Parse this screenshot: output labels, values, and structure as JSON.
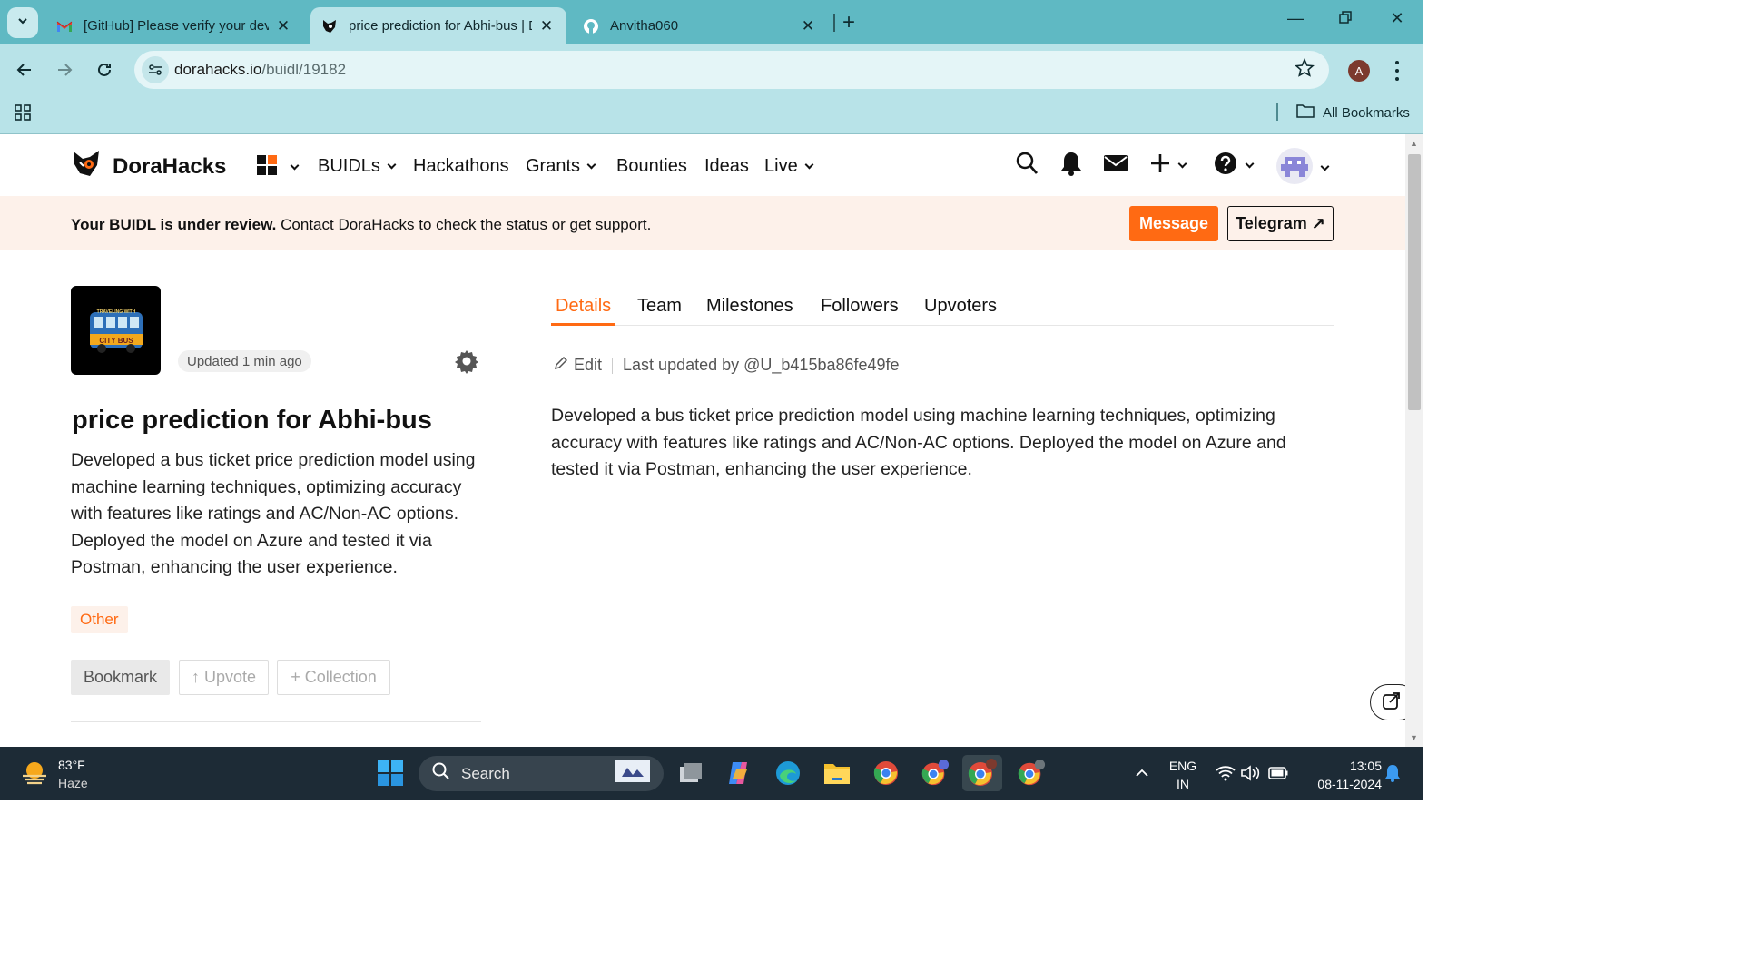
{
  "browser": {
    "tabs": [
      {
        "title": "[GitHub] Please verify your devi",
        "favicon": "gmail-icon",
        "active": false
      },
      {
        "title": "price prediction for Abhi-bus | D",
        "favicon": "dorahacks-icon",
        "active": true
      },
      {
        "title": "Anvitha060",
        "favicon": "github-icon",
        "active": false
      }
    ],
    "url_host": "dorahacks.io",
    "url_path": "/buidl/19182",
    "profile_initial": "A",
    "all_bookmarks": "All Bookmarks"
  },
  "site": {
    "logo": "DoraHacks",
    "nav": [
      {
        "label": "BUIDLs",
        "dropdown": true
      },
      {
        "label": "Hackathons",
        "dropdown": false
      },
      {
        "label": "Grants",
        "dropdown": true
      },
      {
        "label": "Bounties",
        "dropdown": false
      },
      {
        "label": "Ideas",
        "dropdown": false
      },
      {
        "label": "Live",
        "dropdown": true
      }
    ],
    "accent_color": "#ff6a13"
  },
  "banner": {
    "bold": "Your BUIDL is under review.",
    "text": " Contact DoraHacks to check the status or get support.",
    "message_btn": "Message",
    "telegram_btn": "Telegram ↗"
  },
  "project": {
    "updated": "Updated 1 min ago",
    "title": "price prediction for Abhi-bus",
    "description": "Developed a bus ticket price prediction model using machine learning techniques, optimizing accuracy with features like ratings and AC/Non-AC options. Deployed the model on Azure and tested it via Postman, enhancing the user experience.",
    "tag": "Other",
    "bookmark_btn": "Bookmark",
    "upvote_btn": "↑ Upvote",
    "collection_btn": "+ Collection",
    "logo_text_top": "TRAVELING WITH",
    "logo_text_bottom": "CITY BUS"
  },
  "detail": {
    "tabs": [
      "Details",
      "Team",
      "Milestones",
      "Followers",
      "Upvoters"
    ],
    "active_tab": "Details",
    "edit": "Edit",
    "last_updated": "Last updated by @U_b415ba86fe49fe",
    "description": "Developed a bus ticket price prediction model using machine learning techniques, optimizing accuracy with features like ratings and AC/Non-AC options. Deployed the model on Azure and tested it via Postman, enhancing the user experience."
  },
  "taskbar": {
    "temperature": "83°F",
    "condition": "Haze",
    "search": "Search",
    "lang1": "ENG",
    "lang2": "IN",
    "time": "13:05",
    "date": "08-11-2024"
  }
}
